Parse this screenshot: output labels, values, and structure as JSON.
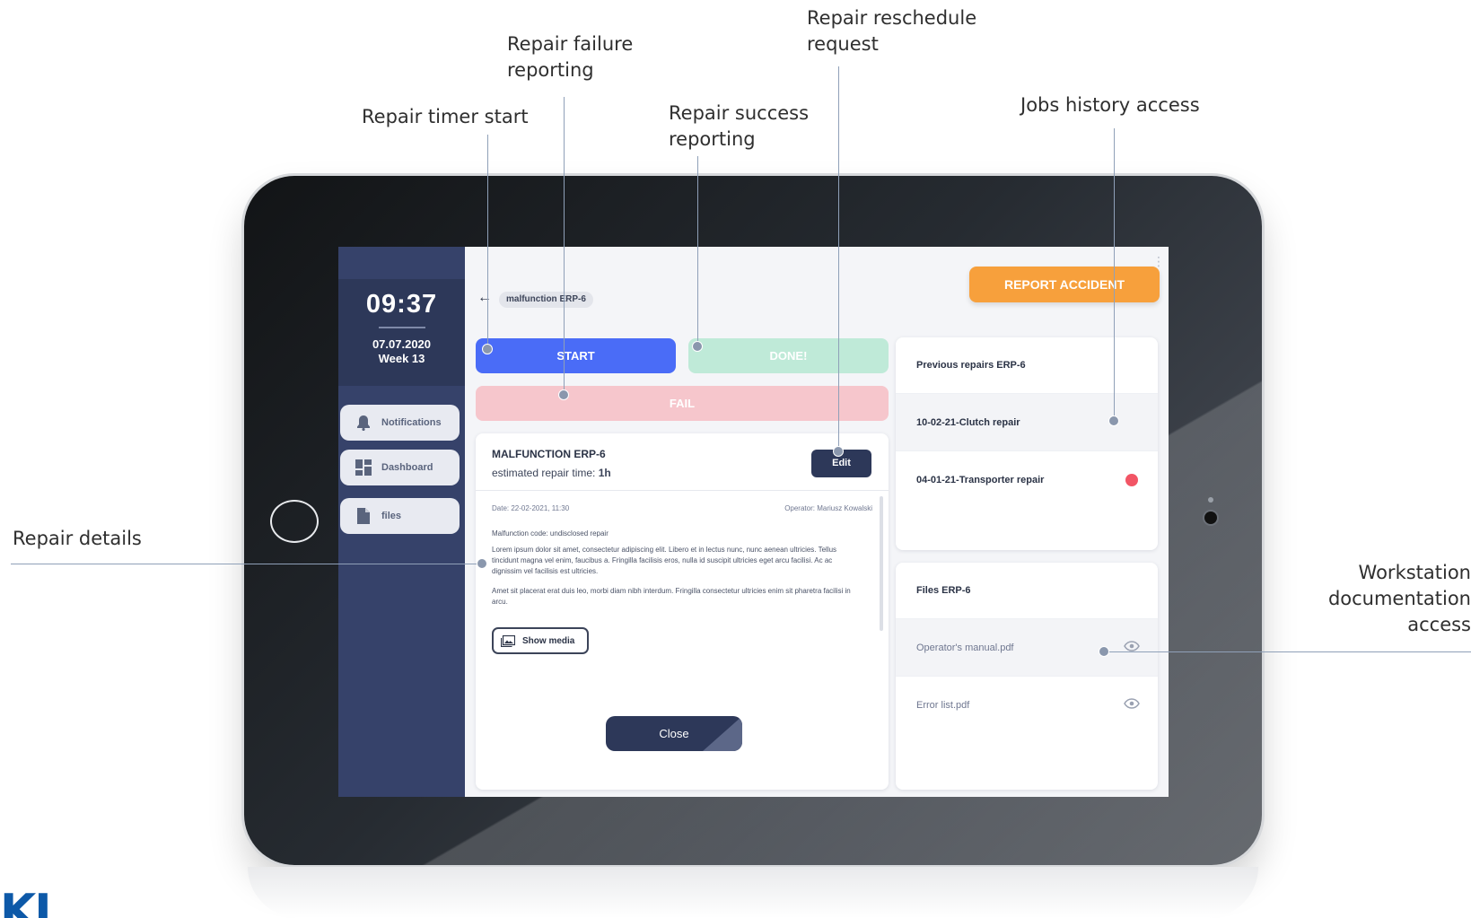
{
  "annotations": {
    "timer_start": "Repair timer start",
    "failure_reporting": "Repair failure\nreporting",
    "success_reporting": "Repair success\nreporting",
    "reschedule_request": "Repair reschedule\nrequest",
    "jobs_history": "Jobs history access",
    "repair_details": "Repair details",
    "workstation_docs": "Workstation\ndocumentation\naccess"
  },
  "sidebar": {
    "time": "09:37",
    "date": "07.07.2020",
    "week": "Week 13",
    "items": [
      {
        "label": "Notifications",
        "icon": "bell-icon"
      },
      {
        "label": "Dashboard",
        "icon": "dashboard-icon"
      },
      {
        "label": "files",
        "icon": "file-icon"
      }
    ]
  },
  "header": {
    "back_icon": "←",
    "breadcrumb": "malfunction ERP-6",
    "report_button": "REPORT ACCIDENT",
    "menu_icon": "⋮"
  },
  "actions": {
    "start": "START",
    "done": "DONE!",
    "fail": "FAIL"
  },
  "details": {
    "title": "MALFUNCTION ERP-6",
    "estimate_prefix": "estimated repair time:",
    "estimate_value": "1h",
    "edit": "Edit",
    "date": "Date: 22-02-2021, 11:30",
    "operator": "Operator: Mariusz Kowalski",
    "code": "Malfunction code: undisclosed repair",
    "paragraph1": "Lorem ipsum dolor sit amet, consectetur adipiscing elit. Libero et in lectus nunc, nunc aenean ultricies. Tellus tincidunt magna vel enim, faucibus a. Fringilla facilisis eros, nulla id suscipit ultricies eget arcu facilisi. Ac ac dignissim vel facilisis est ultricies.",
    "paragraph2": "Amet sit placerat erat duis leo, morbi diam nibh interdum. Fringilla consectetur ultricies enim sit pharetra facilisi in arcu.",
    "show_media": "Show media",
    "close": "Close"
  },
  "history": {
    "title": "Previous repairs ERP-6",
    "items": [
      "10-02-21-Clutch repair",
      "04-01-21-Transporter repair"
    ]
  },
  "files": {
    "title": "Files ERP-6",
    "items": [
      "Operator's manual.pdf",
      "Error list.pdf"
    ]
  },
  "logo_text": "KI",
  "colors": {
    "sidebar": "#36426a",
    "start": "#4a6cf7",
    "done": "#bfead8",
    "fail": "#f6c6cc",
    "accident": "#f7a03c",
    "alert": "#f25565",
    "logo": "#0d59a8"
  }
}
